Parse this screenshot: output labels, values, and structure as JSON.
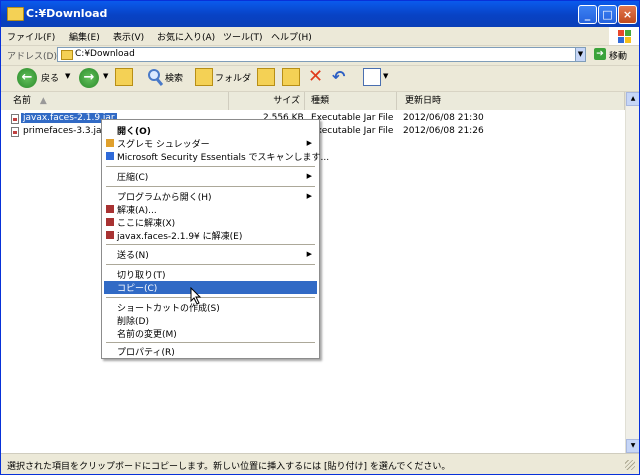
{
  "window": {
    "title": "C:¥Download"
  },
  "menubar": {
    "items": [
      "ファイル(F)",
      "編集(E)",
      "表示(V)",
      "お気に入り(A)",
      "ツール(T)",
      "ヘルプ(H)"
    ]
  },
  "address": {
    "label": "アドレス(D)",
    "value": "C:¥Download",
    "go_label": "移動"
  },
  "toolbar": {
    "back_label": "戻る",
    "search_label": "検索",
    "folders_label": "フォルダ"
  },
  "columns": {
    "name": "名前",
    "size": "サイズ",
    "type": "種類",
    "modified": "更新日時"
  },
  "files": [
    {
      "name": "javax.faces-2.1.9.jar",
      "size": "2,556 KB",
      "type": "Executable Jar File",
      "modified": "2012/06/08 21:30"
    },
    {
      "name": "primefaces-3.3.jar",
      "size": "",
      "type": "Executable Jar File",
      "modified": "2012/06/08 21:26"
    }
  ],
  "context_menu": {
    "items": [
      "開く(O)",
      "スグレモ シュレッダー",
      "Microsoft Security Essentials でスキャンします...",
      "圧縮(C)",
      "プログラムから開く(H)",
      "解凍(A)...",
      "ここに解凍(X)",
      "javax.faces-2.1.9¥ に解凍(E)",
      "送る(N)",
      "切り取り(T)",
      "コピー(C)",
      "ショートカットの作成(S)",
      "削除(D)",
      "名前の変更(M)",
      "プロパティ(R)"
    ]
  },
  "status": {
    "text": "選択された項目をクリップボードにコピーします。新しい位置に挿入するには [貼り付け] を選んでください。"
  },
  "colors": {
    "selection": "#316ac5",
    "titlebar": "#0a5bed",
    "close_button": "#c24a1d"
  }
}
